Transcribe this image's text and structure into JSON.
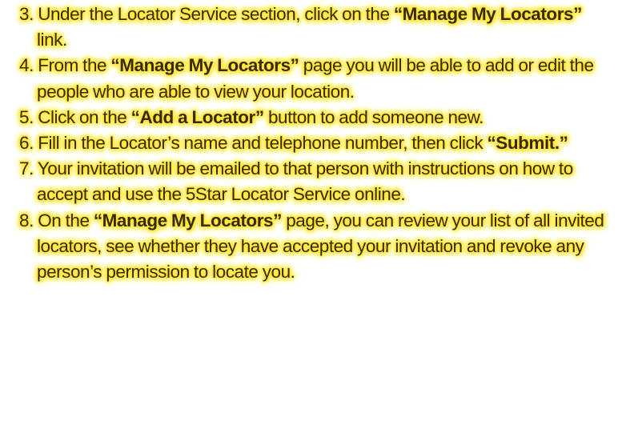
{
  "document": {
    "steps": [
      {
        "num": "3.",
        "t1": "Under the Locator Service section, click on the ",
        "b1": "“Manage My Locators”",
        "t2": " link."
      },
      {
        "num": "4.",
        "t1": "From the ",
        "b1": "“Manage My Locators”",
        "t2": " page you will be able to add or edit the people who are able to view your location."
      },
      {
        "num": "5.",
        "t1": "Click on the ",
        "b1": "“Add a Locator”",
        "t2": " button to add someone new."
      },
      {
        "num": "6.",
        "t1": "Fill in the Locator’s name and telephone number, then click ",
        "b1": "“Submit.”",
        "t2": ""
      },
      {
        "num": "7.",
        "t1": "Your invitation will be emailed to that person with instructions on how to accept and use the 5Star Locator Service online.",
        "b1": "",
        "t2": ""
      },
      {
        "num": "8.",
        "t1": "On the ",
        "b1": "“Manage My Locators”",
        "t2": " page, you can review your list of all invited locators, see whether they have accepted your invitation and revoke any person’s permission to locate you."
      }
    ],
    "highlight_color": "#ffe83d",
    "text_color": "#3a2a00"
  }
}
